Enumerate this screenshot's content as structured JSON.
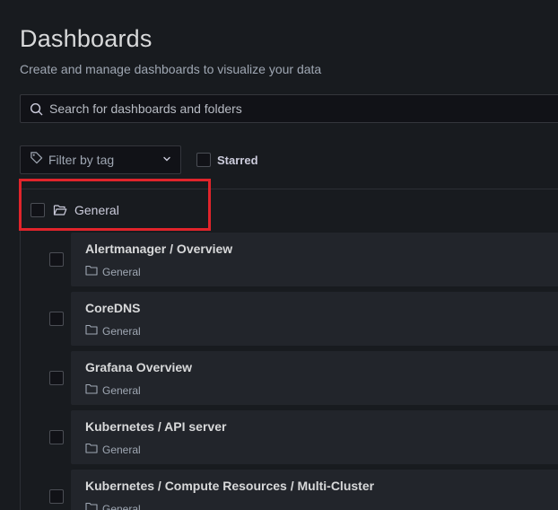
{
  "header": {
    "title": "Dashboards",
    "subtitle": "Create and manage dashboards to visualize your data"
  },
  "search": {
    "placeholder": "Search for dashboards and folders",
    "icon": "search-icon"
  },
  "filters": {
    "tag_label": "Filter by tag",
    "starred_label": "Starred"
  },
  "folder": {
    "label": "General",
    "icon": "folder-open-icon"
  },
  "dashboards": [
    {
      "name": "Alertmanager / Overview",
      "folder": "General"
    },
    {
      "name": "CoreDNS",
      "folder": "General"
    },
    {
      "name": "Grafana Overview",
      "folder": "General"
    },
    {
      "name": "Kubernetes / API server",
      "folder": "General"
    },
    {
      "name": "Kubernetes / Compute Resources / Multi-Cluster",
      "folder": "General"
    }
  ],
  "colors": {
    "background": "#181b1f",
    "card": "#22252b",
    "highlight": "#e0242b"
  }
}
